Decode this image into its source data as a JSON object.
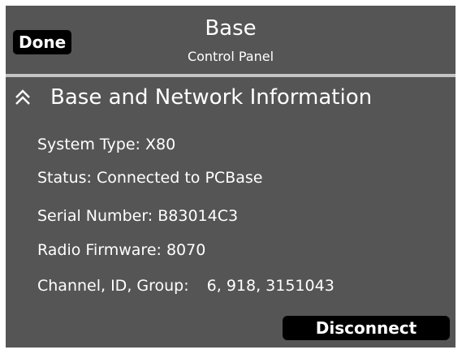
{
  "header": {
    "done_label": "Done",
    "title": "Base",
    "subtitle": "Control Panel"
  },
  "section": {
    "title": "Base and Network Information",
    "icon": "double-chevron-up-icon",
    "lines": [
      "System Type: X80",
      "Status: Connected to PCBase",
      "Serial Number: B83014C3",
      "Radio Firmware: 8070"
    ],
    "channel_label": "Channel, ID, Group:",
    "channel_value": "6, 918, 3151043"
  },
  "footer": {
    "disconnect_label": "Disconnect"
  },
  "colors": {
    "panel_background": "#555555",
    "button_background": "#000000",
    "text": "#ffffff",
    "divider": "#c4c4c4"
  }
}
